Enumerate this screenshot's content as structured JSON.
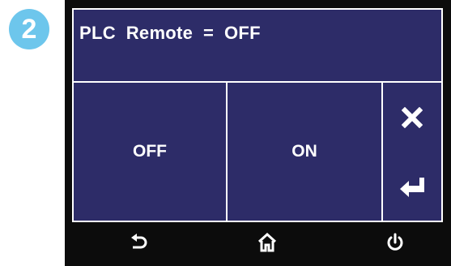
{
  "step": {
    "number": "2"
  },
  "screen": {
    "title": "PLC  Remote  =  OFF",
    "options": [
      {
        "label": "OFF"
      },
      {
        "label": "ON"
      }
    ],
    "side_buttons": {
      "cancel_icon": "close-icon",
      "enter_icon": "enter-return-icon"
    }
  },
  "nav": {
    "back_icon": "back-arrow-icon",
    "home_icon": "home-icon",
    "power_icon": "power-icon"
  },
  "colors": {
    "screen_bg": "#2d2c68",
    "bezel": "#0c0c0c",
    "badge": "#6dc6ec",
    "text": "#ffffff"
  }
}
